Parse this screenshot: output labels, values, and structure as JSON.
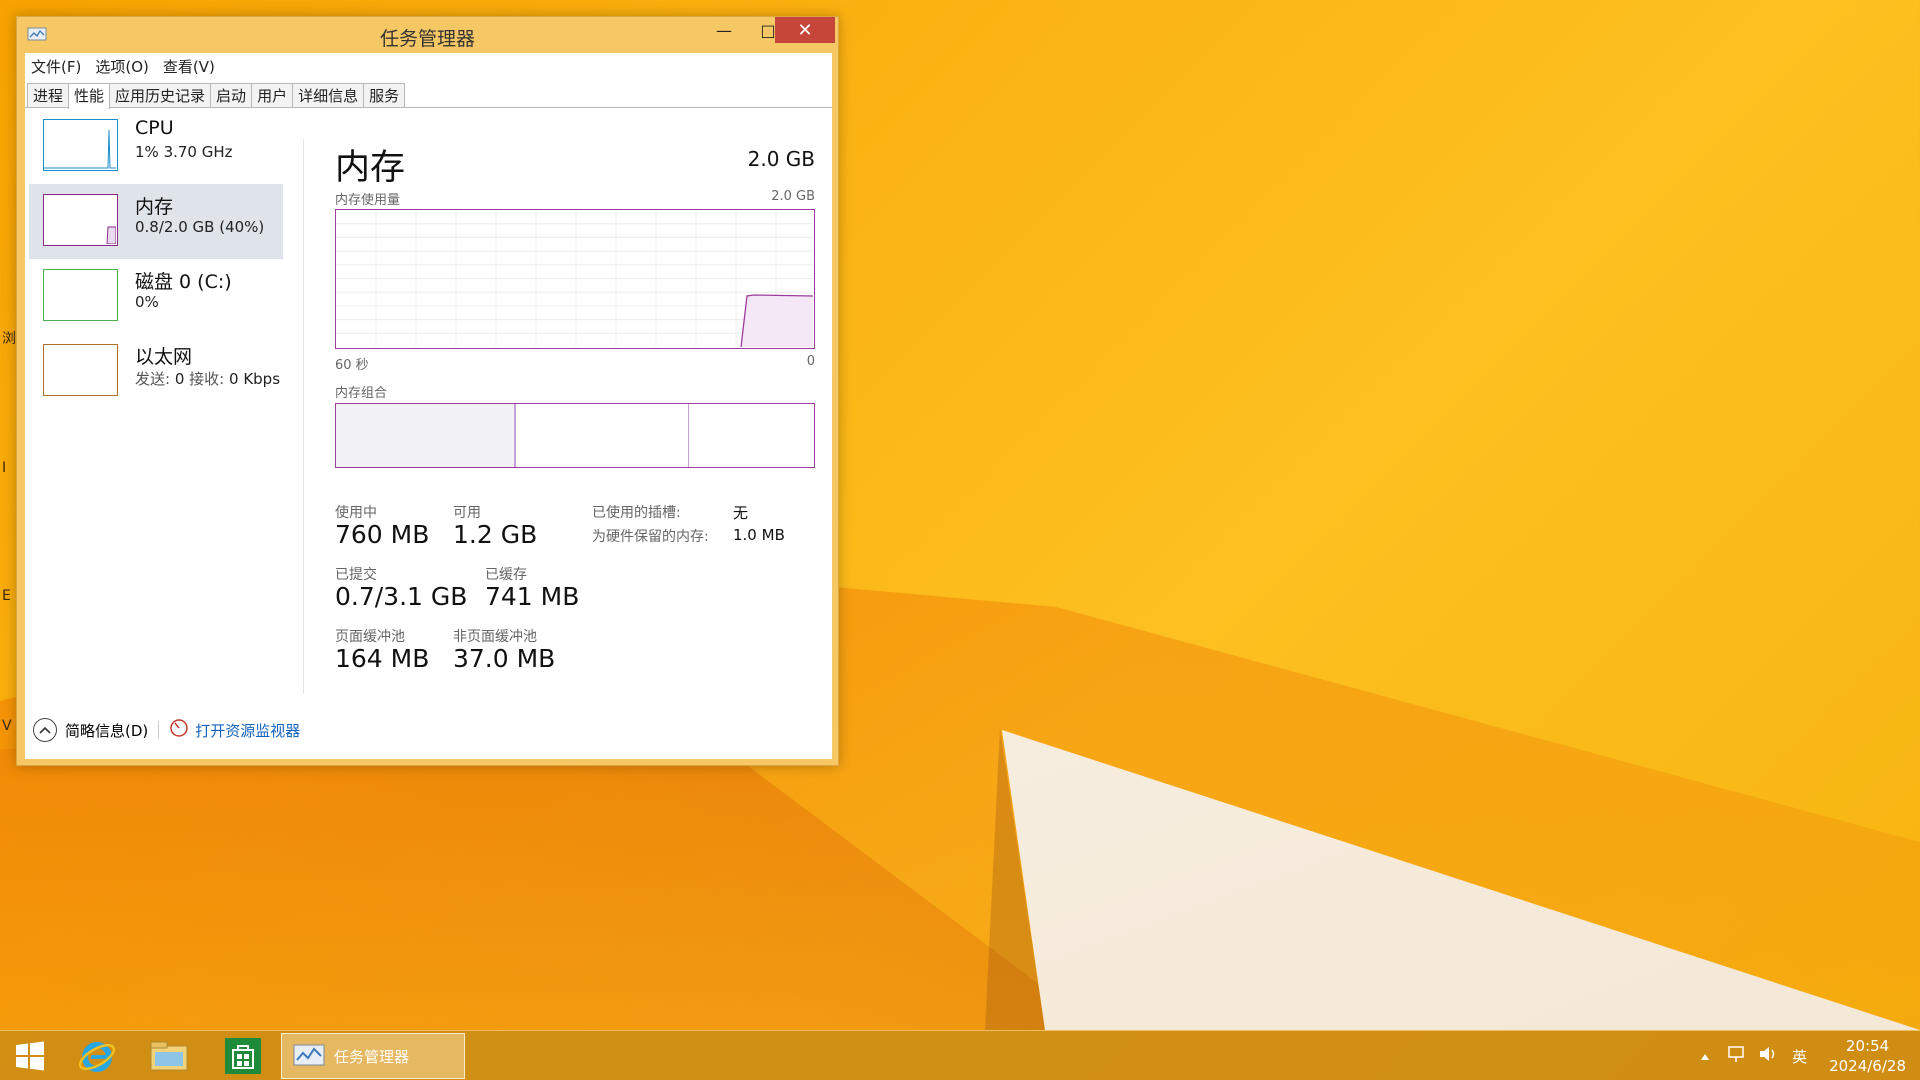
{
  "window": {
    "title": "任务管理器",
    "min_glyph": "—",
    "max_glyph": "□",
    "close_glyph": "✕"
  },
  "menu": [
    "文件(F)",
    "选项(O)",
    "查看(V)"
  ],
  "tabs": [
    "进程",
    "性能",
    "应用历史记录",
    "启动",
    "用户",
    "详细信息",
    "服务"
  ],
  "active_tab": "性能",
  "nav": [
    {
      "title": "CPU",
      "sub": "1% 3.70 GHz",
      "color": "#1a8fc9"
    },
    {
      "title": "内存",
      "sub": "0.8/2.0 GB (40%)",
      "color": "#8b2a8b"
    },
    {
      "title": "磁盘 0 (C:)",
      "sub": "0%",
      "color": "#4caf50"
    },
    {
      "title": "以太网",
      "sub_prefix": "发送:",
      "sub_send": "0",
      "sub_mid": "接收:",
      "sub_recv": "0 Kbps",
      "color": "#b07030"
    }
  ],
  "detail": {
    "title": "内存",
    "total": "2.0 GB",
    "usage_label": "内存使用量",
    "usage_max": "2.0 GB",
    "x_left": "60 秒",
    "x_right": "0",
    "composition_label": "内存组合",
    "stats": {
      "in_use_label": "使用中",
      "in_use": "760 MB",
      "available_label": "可用",
      "available": "1.2 GB",
      "committed_label": "已提交",
      "committed": "0.7/3.1 GB",
      "cached_label": "已缓存",
      "cached": "741 MB",
      "paged_label": "页面缓冲池",
      "paged": "164 MB",
      "nonpaged_label": "非页面缓冲池",
      "nonpaged": "37.0 MB"
    },
    "kv": {
      "slots_label": "已使用的插槽:",
      "slots": "无",
      "reserved_label": "为硬件保留的内存:",
      "reserved": "1.0 MB"
    }
  },
  "footer": {
    "fewer_details": "简略信息(D)",
    "open_monitor": "打开资源监视器"
  },
  "taskbar": {
    "task_label": "任务管理器",
    "ime": "英",
    "time": "20:54",
    "date": "2024/6/28"
  },
  "desktop_edge": [
    "浏",
    "I",
    "E",
    "V"
  ],
  "colors": {
    "memory_accent": "#9c3c9c",
    "close_red": "#c7463a",
    "window_frame": "#f6c865"
  }
}
